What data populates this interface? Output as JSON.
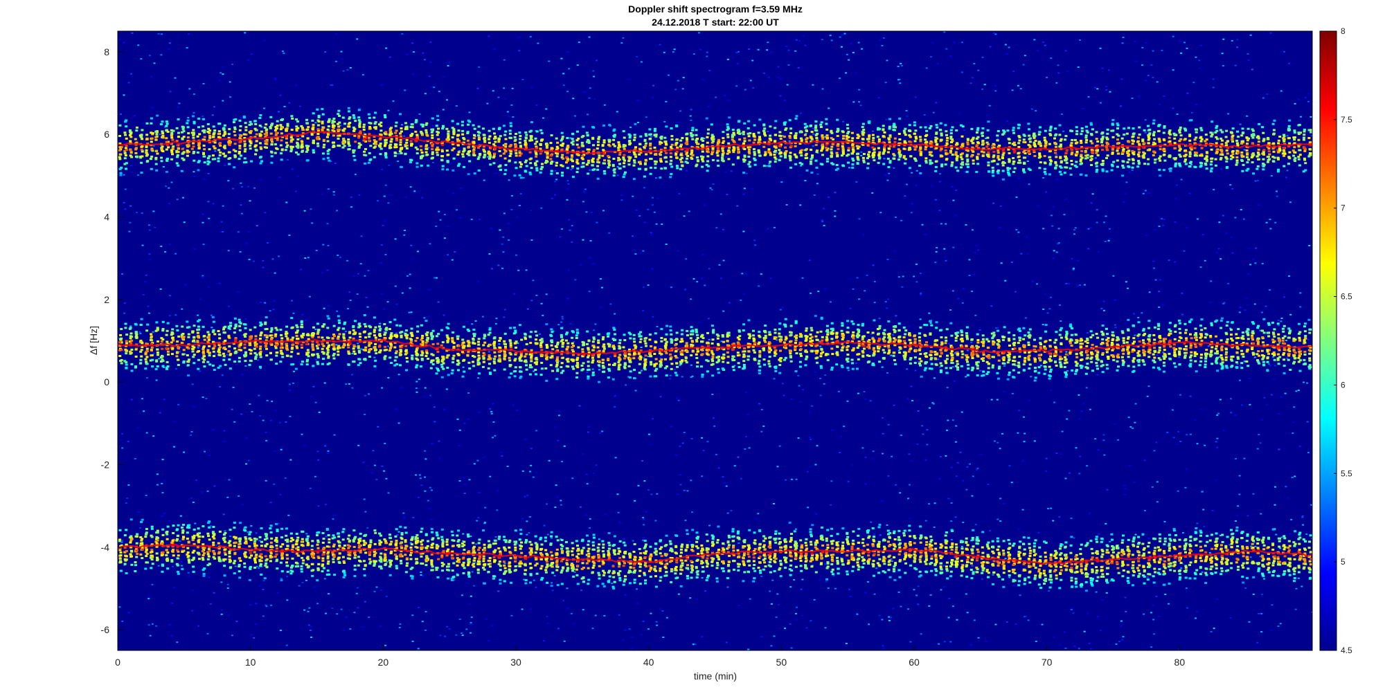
{
  "figure": {
    "title_line1": "Doppler shift spectrogram f=3.59 MHz",
    "title_line2": "24.12.2018   T start: 22:00 UT",
    "xlabel": "time (min)",
    "ylabel": "Δf [Hz]"
  },
  "chart_data": {
    "type": "heatmap",
    "title": "Doppler shift spectrogram f=3.59 MHz",
    "subtitle": "24.12.2018   T start: 22:00 UT",
    "xlabel": "time (min)",
    "ylabel": "Δf [Hz]",
    "xlim": [
      0,
      90
    ],
    "ylim": [
      -6.5,
      8.5
    ],
    "x_ticks": [
      "0",
      "10",
      "20",
      "30",
      "40",
      "50",
      "60",
      "70",
      "80"
    ],
    "x_tick_values": [
      0,
      10,
      20,
      30,
      40,
      50,
      60,
      70,
      80
    ],
    "y_ticks": [
      "8",
      "6",
      "4",
      "2",
      "0",
      "-2",
      "-4",
      "-6"
    ],
    "y_tick_values": [
      8,
      6,
      4,
      2,
      0,
      -2,
      -4,
      -6
    ],
    "colorbar": {
      "range": [
        4.5,
        8
      ],
      "ticks": [
        "8",
        "7.5",
        "7",
        "6.5",
        "6",
        "5.5",
        "5",
        "4.5"
      ],
      "tick_values": [
        8,
        7.5,
        7,
        6.5,
        6,
        5.5,
        5,
        4.5
      ],
      "colormap": "jet"
    },
    "bands": [
      {
        "time_min": [
          0,
          5,
          10,
          15,
          20,
          25,
          30,
          35,
          40,
          45,
          50,
          55,
          60,
          65,
          70,
          75,
          80,
          85,
          90
        ],
        "delta_f_hz": [
          5.75,
          5.8,
          5.9,
          6.05,
          5.95,
          5.8,
          5.65,
          5.55,
          5.6,
          5.7,
          5.8,
          5.8,
          5.75,
          5.65,
          5.65,
          5.7,
          5.75,
          5.7,
          5.75
        ]
      },
      {
        "time_min": [
          0,
          5,
          10,
          15,
          20,
          25,
          30,
          35,
          40,
          45,
          50,
          55,
          60,
          65,
          70,
          75,
          80,
          85,
          90
        ],
        "delta_f_hz": [
          0.9,
          0.9,
          1.0,
          1.0,
          1.0,
          0.8,
          0.75,
          0.7,
          0.75,
          0.85,
          0.9,
          0.95,
          0.9,
          0.75,
          0.75,
          0.85,
          0.95,
          0.9,
          0.85
        ]
      },
      {
        "time_min": [
          0,
          5,
          10,
          15,
          20,
          25,
          30,
          35,
          40,
          45,
          50,
          55,
          60,
          65,
          70,
          75,
          80,
          85,
          90
        ],
        "delta_f_hz": [
          -4.0,
          -3.95,
          -4.05,
          -4.1,
          -4.05,
          -4.15,
          -4.2,
          -4.3,
          -4.35,
          -4.15,
          -4.1,
          -4.1,
          -4.05,
          -4.25,
          -4.4,
          -4.3,
          -4.2,
          -4.1,
          -4.2
        ]
      }
    ],
    "background_level": 4.8,
    "band_peak_level": 7.6,
    "grid": false,
    "legend": false
  },
  "colors": {
    "background_low": "#00008F",
    "peak": "#FF0000"
  }
}
